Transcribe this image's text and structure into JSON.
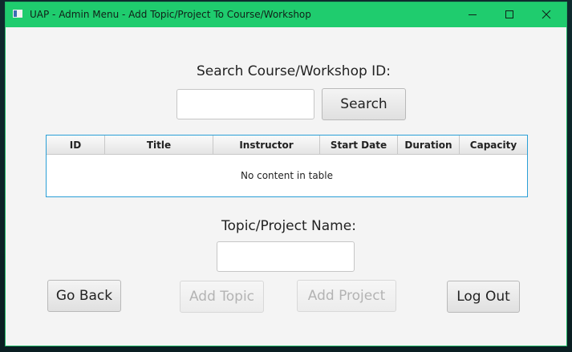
{
  "window": {
    "title": "UAP - Admin Menu - Add Topic/Project To Course/Workshop",
    "accent_color": "#1fcc6e"
  },
  "search": {
    "label": "Search Course/Workshop ID:",
    "value": "",
    "placeholder": "",
    "button_label": "Search"
  },
  "table": {
    "columns": [
      "ID",
      "Title",
      "Instructor",
      "Start Date",
      "Duration",
      "Capacity"
    ],
    "rows": [],
    "placeholder": "No content in table"
  },
  "topic_project": {
    "label": "Topic/Project Name:",
    "value": "",
    "placeholder": ""
  },
  "actions": {
    "go_back_label": "Go Back",
    "add_topic_label": "Add Topic",
    "add_topic_enabled": false,
    "add_project_label": "Add Project",
    "add_project_enabled": false,
    "log_out_label": "Log Out"
  },
  "icons": {
    "app": "app-icon",
    "minimize": "minimize-icon",
    "maximize": "maximize-icon",
    "close": "close-icon"
  }
}
